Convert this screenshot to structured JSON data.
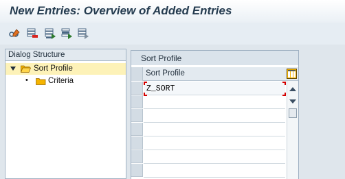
{
  "window": {
    "title": "New Entries: Overview of Added Entries"
  },
  "toolbar": {
    "buttons": [
      {
        "icon": "display-change-icon"
      },
      {
        "icon": "delete-row-icon"
      },
      {
        "icon": "select-all-icon"
      },
      {
        "icon": "select-block-icon"
      },
      {
        "icon": "deselect-all-icon"
      }
    ]
  },
  "dialog_structure": {
    "header": "Dialog Structure",
    "items": [
      {
        "label": "Sort Profile",
        "selected": true,
        "expanded": true
      },
      {
        "label": "Criteria",
        "selected": false
      }
    ]
  },
  "sort_profile_panel": {
    "title": "Sort Profile",
    "column_header": "Sort Profile",
    "rows": [
      "Z_SORT",
      "",
      "",
      "",
      "",
      "",
      ""
    ]
  },
  "colors": {
    "title_text": "#243b4f",
    "selected_row": "#fdf2b8",
    "folder": "#f5b400",
    "focus": "#d40000"
  }
}
